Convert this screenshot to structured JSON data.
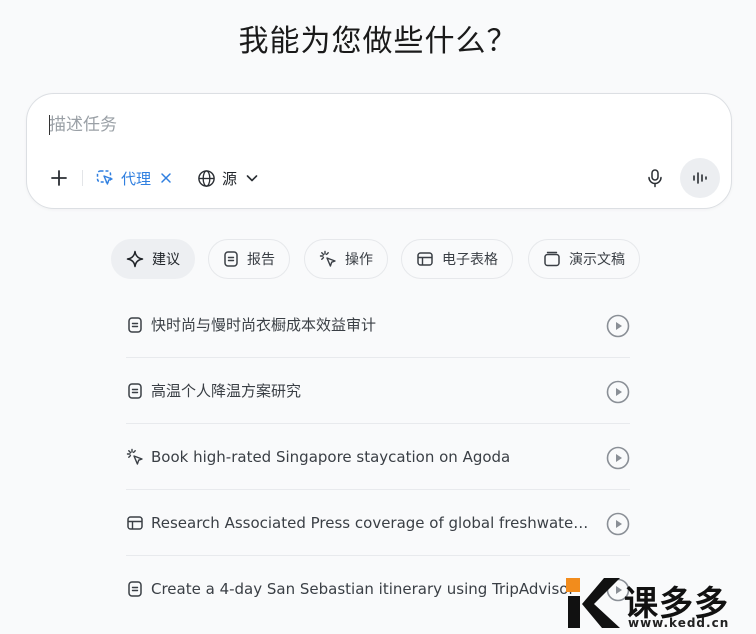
{
  "page": {
    "title": "我能为您做些什么？"
  },
  "composer": {
    "placeholder": "描述任务",
    "agent_label": "代理",
    "source_label": "源",
    "icons": [
      "plus-icon",
      "agent-cursor-icon",
      "close-icon",
      "globe-icon",
      "chevron-down-icon",
      "microphone-icon",
      "voice-wave-icon"
    ]
  },
  "tabs": [
    {
      "label": "建议",
      "icon": "sparkle-icon",
      "active": true
    },
    {
      "label": "报告",
      "icon": "document-icon",
      "active": false
    },
    {
      "label": "操作",
      "icon": "cursor-click-icon",
      "active": false
    },
    {
      "label": "电子表格",
      "icon": "table-icon",
      "active": false
    },
    {
      "label": "演示文稿",
      "icon": "slides-icon",
      "active": false
    }
  ],
  "suggestions": [
    {
      "text": "快时尚与慢时尚衣橱成本效益审计",
      "icon": "document-icon"
    },
    {
      "text": "高温个人降温方案研究",
      "icon": "document-icon"
    },
    {
      "text": "Book high-rated Singapore staycation on Agoda",
      "icon": "cursor-click-icon"
    },
    {
      "text": "Research Associated Press coverage of global freshwater s...",
      "icon": "table-icon"
    },
    {
      "text": "Create a 4-day San Sebastian itinerary using TripAdvisor",
      "icon": "document-icon"
    }
  ],
  "watermark": {
    "brand": "课多多",
    "url": "www.kedd.cn"
  },
  "colors": {
    "accent": "#2f7fe0",
    "background": "#f9fafb",
    "watermark_orange": "#f28c1c"
  }
}
